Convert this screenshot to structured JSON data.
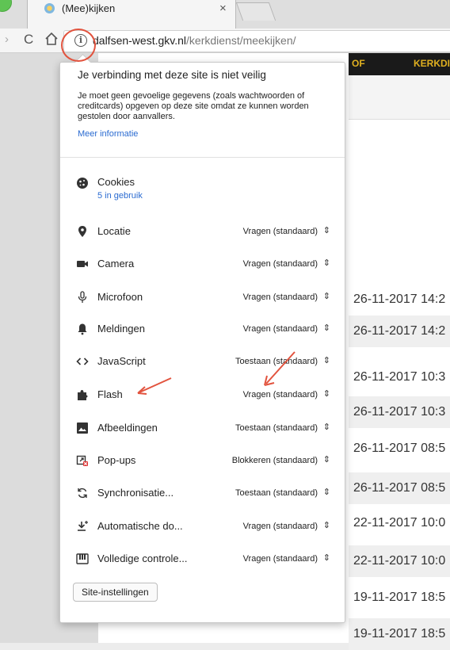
{
  "browser": {
    "tab_title": "(Mee)kijken",
    "tab_close": "×",
    "url_host": "dalfsen-west.gkv.nl",
    "url_path": "/kerkdienst/meekijken/"
  },
  "page_behind": {
    "nav_items": [
      "OF",
      "KERKDIE"
    ],
    "dates": [
      "26-11-2017 14:2",
      "26-11-2017 14:2",
      "26-11-2017 10:3",
      "26-11-2017 10:3",
      "26-11-2017 08:5",
      "26-11-2017 08:5",
      "22-11-2017 10:0",
      "22-11-2017 10:0",
      "19-11-2017 18:5",
      "19-11-2017 18:5"
    ]
  },
  "popup": {
    "security_title": "Je verbinding met deze site is niet veilig",
    "security_body": "Je moet geen gevoelige gegevens (zoals wachtwoorden of creditcards) opgeven op deze site omdat ze kunnen worden gestolen door aanvallers.",
    "more_info": "Meer informatie",
    "cookies": {
      "label": "Cookies",
      "in_use": "5 in gebruik"
    },
    "permissions": [
      {
        "icon": "location-pin-icon",
        "label": "Locatie",
        "value": "Vragen (standaard)"
      },
      {
        "icon": "camera-icon",
        "label": "Camera",
        "value": "Vragen (standaard)"
      },
      {
        "icon": "microphone-icon",
        "label": "Microfoon",
        "value": "Vragen (standaard)"
      },
      {
        "icon": "bell-icon",
        "label": "Meldingen",
        "value": "Vragen (standaard)"
      },
      {
        "icon": "code-icon",
        "label": "JavaScript",
        "value": "Toestaan (standaard)"
      },
      {
        "icon": "puzzle-icon",
        "label": "Flash",
        "value": "Vragen (standaard)"
      },
      {
        "icon": "image-icon",
        "label": "Afbeeldingen",
        "value": "Toestaan (standaard)"
      },
      {
        "icon": "popup-blocked-icon",
        "label": "Pop-ups",
        "value": "Blokkeren (standaard)"
      },
      {
        "icon": "sync-icon",
        "label": "Synchronisatie...",
        "value": "Toestaan (standaard)"
      },
      {
        "icon": "download-icon",
        "label": "Automatische do...",
        "value": "Vragen (standaard)"
      },
      {
        "icon": "midi-icon",
        "label": "Volledige controle...",
        "value": "Vragen (standaard)"
      }
    ],
    "site_settings_button": "Site-instellingen"
  },
  "colors": {
    "link": "#2a6bd1",
    "annotation": "#e2533e",
    "nav_bg": "#1a1a1a",
    "nav_text": "#e0b020"
  }
}
